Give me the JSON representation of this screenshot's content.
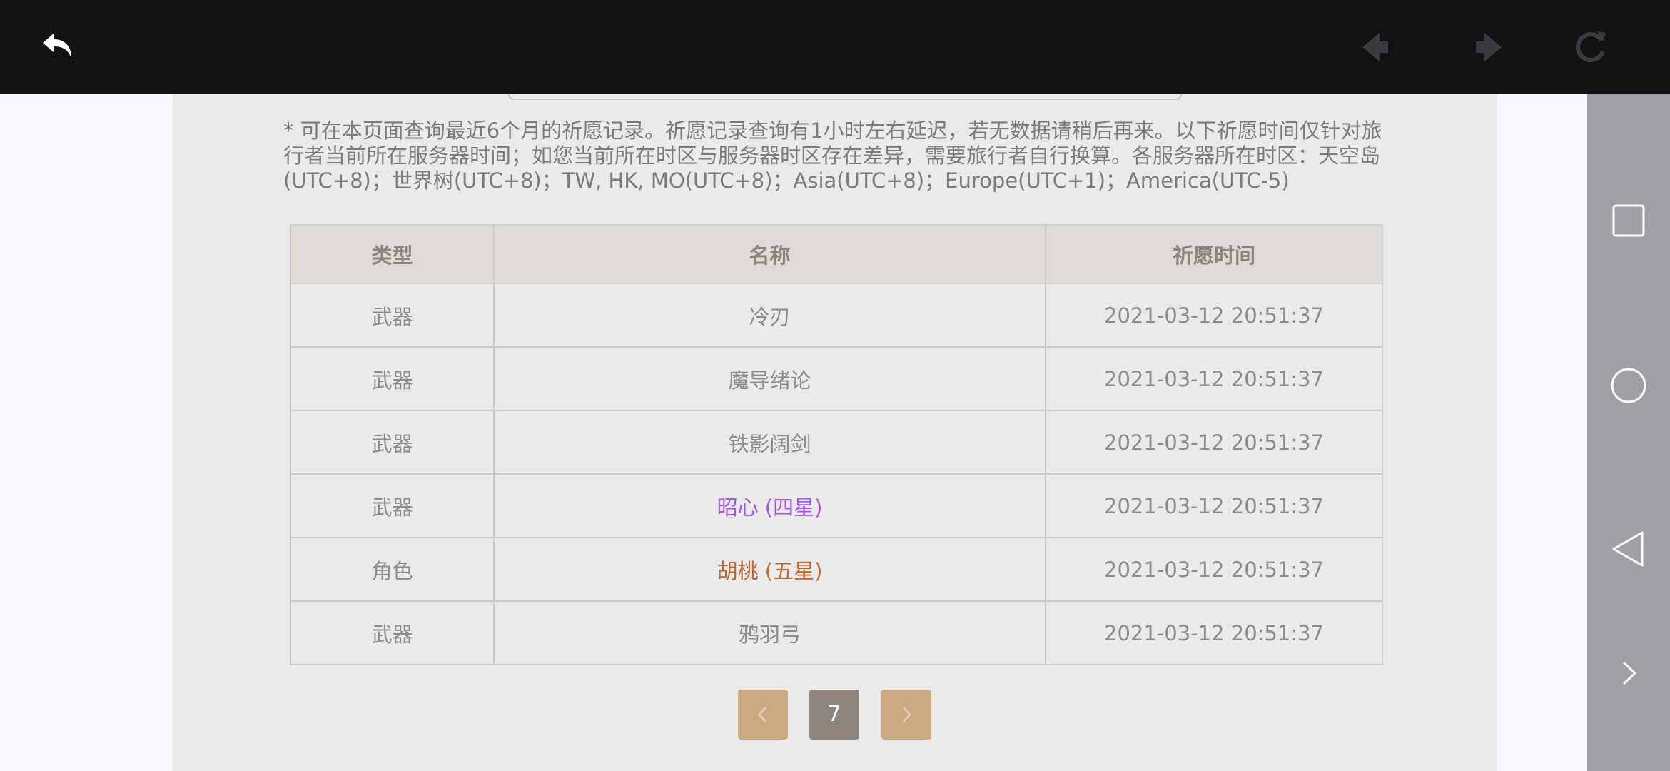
{
  "icons": {
    "back": "back-arrow-icon",
    "nav_back": "diamond-left-icon",
    "nav_forward": "diamond-right-icon",
    "refresh": "refresh-icon",
    "android_recents": "square-icon",
    "android_home": "circle-icon",
    "android_back": "triangle-icon",
    "expand": "chevron-right-icon"
  },
  "notice": "* 可在本页面查询最近6个月的祈愿记录。祈愿记录查询有1小时左右延迟，若无数据请稍后再来。以下祈愿时间仅针对旅行者当前所在服务器时间；如您当前所在时区与服务器时区存在差异，需要旅行者自行换算。各服务器所在时区：天空岛(UTC+8)；世界树(UTC+8)；TW, HK, MO(UTC+8)；Asia(UTC+8)；Europe(UTC+1)；America(UTC-5)",
  "table": {
    "headers": {
      "type": "类型",
      "name": "名称",
      "time": "祈愿时间"
    },
    "rows": [
      {
        "type": "武器",
        "name": "冷刃",
        "time": "2021-03-12 20:51:37"
      },
      {
        "type": "武器",
        "name": "魔导绪论",
        "time": "2021-03-12 20:51:37"
      },
      {
        "type": "武器",
        "name": "铁影阔剑",
        "time": "2021-03-12 20:51:37"
      },
      {
        "type": "武器",
        "name": "昭心 (四星)",
        "time": "2021-03-12 20:51:37"
      },
      {
        "type": "角色",
        "name": "胡桃 (五星)",
        "time": "2021-03-12 20:51:37"
      },
      {
        "type": "武器",
        "name": "鸦羽弓",
        "time": "2021-03-12 20:51:37"
      }
    ]
  },
  "pagination": {
    "current": "7"
  },
  "colors": {
    "four_star": "#a256e1",
    "five_star": "#bd6932",
    "pager_arrow": "#cca981",
    "pager_current": "#8f847c",
    "header_bg": "#dedbd7",
    "panel_bg": "#ebeaea",
    "topbar_bg": "#111214"
  }
}
